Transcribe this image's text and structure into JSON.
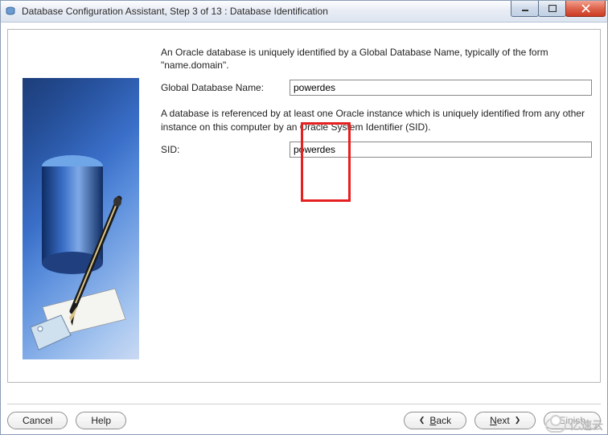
{
  "window": {
    "title": "Database Configuration Assistant, Step 3 of 13 : Database Identification"
  },
  "content": {
    "intro": "An Oracle database is uniquely identified by a Global Database Name, typically of the form \"name.domain\".",
    "gdn_label": "Global Database Name:",
    "gdn_value": "powerdes",
    "sid_intro": "A database is referenced by at least one Oracle instance which is uniquely identified from any other instance on this computer by an Oracle System Identifier (SID).",
    "sid_label": "SID:",
    "sid_value": "powerdes"
  },
  "buttons": {
    "cancel": "Cancel",
    "help": "Help",
    "back": "Back",
    "next": "Next",
    "finish": "Finish"
  },
  "watermark": "亿速云"
}
